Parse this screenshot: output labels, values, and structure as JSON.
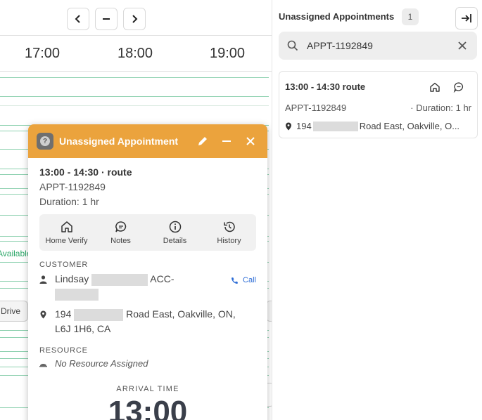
{
  "calendar": {
    "times": [
      "17:00",
      "18:00",
      "19:00"
    ],
    "available_label": "Available",
    "drive_label": "Drive"
  },
  "popup": {
    "title": "Unassigned Appointment",
    "help_symbol": "?",
    "appt_title": "13:00 - 14:30 · route",
    "appt_id": "APPT-1192849",
    "duration": "Duration: 1 hr",
    "actions": [
      {
        "label": "Home Verify",
        "icon": "home-icon"
      },
      {
        "label": "Notes",
        "icon": "chat-icon"
      },
      {
        "label": "Details",
        "icon": "info-icon"
      },
      {
        "label": "History",
        "icon": "history-icon"
      }
    ],
    "customer": {
      "section": "CUSTOMER",
      "name_first": "Lindsay",
      "acc_prefix": "ACC-",
      "call_label": "Call",
      "addr_number": "194",
      "addr_rest": "Road East, Oakville, ON,",
      "addr_line2": "L6J 1H6, CA"
    },
    "resource": {
      "section": "RESOURCE",
      "value": "No Resource Assigned"
    },
    "arrival": {
      "label": "ARRIVAL TIME",
      "time": "13:00"
    }
  },
  "panel": {
    "title": "Unassigned Appointments",
    "count": "1",
    "search_value": "APPT-1192849",
    "card": {
      "title": "13:00 - 14:30 route",
      "id": "APPT-1192849",
      "duration": "· Duration: 1 hr",
      "addr_number": "194",
      "addr_rest": "Road East, Oakville, O..."
    }
  },
  "colors": {
    "popup_header": "#eba33d",
    "grid_line": "#8ed1b0",
    "link": "#2c6cd6"
  }
}
